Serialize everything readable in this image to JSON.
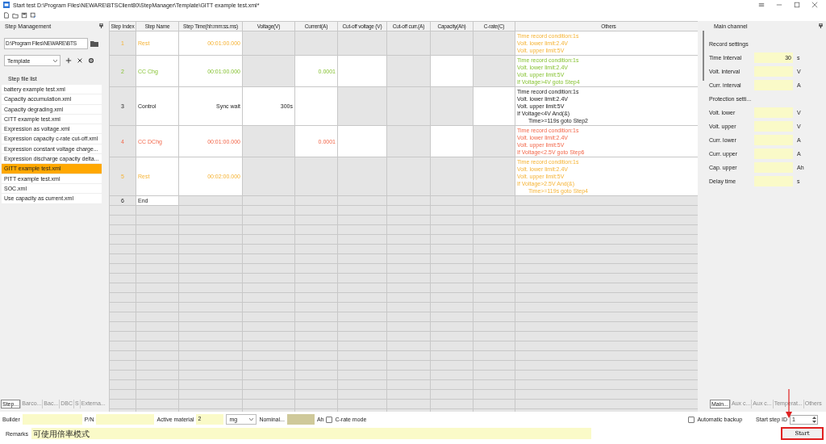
{
  "window": {
    "title": "Start test D:\\Program Files\\NEWARE\\BTSClient80\\StepManager\\Template\\GITT example test.xml*"
  },
  "step_management": {
    "title": "Step Management",
    "path": "D:\\Program Files\\NEWARE\\BTS",
    "category": "Template",
    "list_title": "Step file list",
    "files": [
      {
        "name": "battery example test.xml",
        "selected": false
      },
      {
        "name": "Capacity accumulation.xml",
        "selected": false
      },
      {
        "name": "Capacity degrading.xml",
        "selected": false
      },
      {
        "name": "CITT example test.xml",
        "selected": false
      },
      {
        "name": "Expression as voltage.xml",
        "selected": false
      },
      {
        "name": "Expression capacity c-rate cut-off.xml",
        "selected": false
      },
      {
        "name": "Expression constant voltage charge...",
        "selected": false
      },
      {
        "name": "Expression discharge capacity delta...",
        "selected": false
      },
      {
        "name": "GITT example test.xml",
        "selected": true
      },
      {
        "name": "PITT example test.xml",
        "selected": false
      },
      {
        "name": "SOC.xml",
        "selected": false
      },
      {
        "name": "Use capacity as current.xml",
        "selected": false
      }
    ],
    "tabs": [
      {
        "label": "Step...",
        "selected": true
      },
      {
        "label": "Barco...",
        "selected": false
      },
      {
        "label": "Bac...",
        "selected": false
      },
      {
        "label": "DBC",
        "selected": false
      },
      {
        "label": "S",
        "selected": false
      },
      {
        "label": "Externa...",
        "selected": false
      }
    ]
  },
  "table": {
    "columns": [
      "Step Index",
      "Step Name",
      "Step Time(hh:mm:ss.ms)",
      "Voltage(V)",
      "Current(A)",
      "Cut-off voltage (V)",
      "Cut-off curr.(A)",
      "Capacity(Ah)",
      "C-rate(C)",
      "Others"
    ],
    "rows": [
      {
        "kind": "rest",
        "cells": [
          {
            "text": "1",
            "editable": false
          },
          {
            "text": "Rest",
            "editable": true
          },
          {
            "text": "00:01:00.000",
            "editable": true
          },
          {
            "editable": false
          },
          {
            "editable": false
          },
          {
            "editable": false
          },
          {
            "editable": false
          },
          {
            "editable": false
          },
          {
            "editable": false
          }
        ],
        "others": {
          "editable": true,
          "lines": [
            {
              "text": "Time record condition:1s",
              "indent": false
            },
            {
              "text": "Volt. lower limit:2.4V",
              "indent": false
            },
            {
              "text": "Volt. upper limit:5V",
              "indent": false
            }
          ]
        }
      },
      {
        "kind": "cc_chg",
        "cells": [
          {
            "text": "2",
            "editable": false
          },
          {
            "text": "CC Chg",
            "editable": true
          },
          {
            "text": "00:01:00.000",
            "editable": true
          },
          {
            "editable": false
          },
          {
            "text": "0.0001",
            "editable": true
          },
          {
            "editable": true
          },
          {
            "editable": false
          },
          {
            "editable": true
          },
          {
            "editable": false
          }
        ],
        "others": {
          "editable": true,
          "lines": [
            {
              "text": "Time record condition:1s",
              "indent": false
            },
            {
              "text": "Volt. lower limit:2.4V",
              "indent": false
            },
            {
              "text": "Volt. upper limit:5V",
              "indent": false
            },
            {
              "text": "If Voltage>4V goto Step4",
              "indent": false
            }
          ]
        }
      },
      {
        "kind": "control",
        "cells": [
          {
            "text": "3",
            "editable": false
          },
          {
            "text": "Control",
            "editable": true
          },
          {
            "text": "Sync wait",
            "editable": true
          },
          {
            "text": "300s",
            "editable": true
          },
          {
            "editable": true
          },
          {
            "editable": false
          },
          {
            "editable": false
          },
          {
            "editable": false
          },
          {
            "editable": true
          }
        ],
        "others": {
          "editable": true,
          "lines": [
            {
              "text": "Time record condition:1s",
              "indent": false
            },
            {
              "text": "Volt. lower limit:2.4V",
              "indent": false
            },
            {
              "text": "Volt. upper limit:5V",
              "indent": false
            },
            {
              "text": "If Voltage<4V And(&)",
              "indent": false
            },
            {
              "text": "Time>=119s goto Step2",
              "indent": true
            }
          ]
        }
      },
      {
        "kind": "cc_dchg",
        "cells": [
          {
            "text": "4",
            "editable": false
          },
          {
            "text": "CC DChg",
            "editable": true
          },
          {
            "text": "00:01:00.000",
            "editable": true
          },
          {
            "editable": false
          },
          {
            "text": "0.0001",
            "editable": true
          },
          {
            "editable": true
          },
          {
            "editable": false
          },
          {
            "editable": true
          },
          {
            "editable": false
          }
        ],
        "others": {
          "editable": true,
          "lines": [
            {
              "text": "Time record condition:1s",
              "indent": false
            },
            {
              "text": "Volt. lower limit:2.4V",
              "indent": false
            },
            {
              "text": "Volt. upper limit:5V",
              "indent": false
            },
            {
              "text": "If Voltage<2.5V goto Step6",
              "indent": false
            }
          ]
        }
      },
      {
        "kind": "rest",
        "cells": [
          {
            "text": "5",
            "editable": false
          },
          {
            "text": "Rest",
            "editable": true
          },
          {
            "text": "00:02:00.000",
            "editable": true
          },
          {
            "editable": false
          },
          {
            "editable": false
          },
          {
            "editable": false
          },
          {
            "editable": false
          },
          {
            "editable": false
          },
          {
            "editable": false
          }
        ],
        "others": {
          "editable": true,
          "lines": [
            {
              "text": "Time record condition:1s",
              "indent": false
            },
            {
              "text": "Volt. lower limit:2.4V",
              "indent": false
            },
            {
              "text": "Volt. upper limit:5V",
              "indent": false
            },
            {
              "text": "If Voltage>2.5V And(&)",
              "indent": false
            },
            {
              "text": "Time>=119s goto Step4",
              "indent": true
            }
          ]
        }
      },
      {
        "kind": "end",
        "cells": [
          {
            "text": "6",
            "editable": false
          },
          {
            "text": "End",
            "editable": true
          },
          {
            "editable": false
          },
          {
            "editable": false
          },
          {
            "editable": false
          },
          {
            "editable": false
          },
          {
            "editable": false
          },
          {
            "editable": false
          },
          {
            "editable": false
          }
        ],
        "others": {
          "editable": false
        }
      }
    ]
  },
  "main_channel": {
    "title": "Main channel",
    "settings": [
      {
        "kind": "heading",
        "label": "Record settings"
      },
      {
        "kind": "field",
        "label": "Time Interval",
        "value": "30",
        "unit": "s"
      },
      {
        "kind": "field",
        "label": "Volt. interval",
        "unit": "V"
      },
      {
        "kind": "field",
        "label": "Curr. interval",
        "unit": "A"
      },
      {
        "kind": "heading",
        "label": "Protection setti..."
      },
      {
        "kind": "field",
        "label": "Volt. lower",
        "unit": "V"
      },
      {
        "kind": "field",
        "label": "Volt. upper",
        "unit": "V"
      },
      {
        "kind": "field",
        "label": "Curr. lower",
        "unit": "A"
      },
      {
        "kind": "field",
        "label": "Curr. upper",
        "unit": "A"
      },
      {
        "kind": "field",
        "label": "Cap. upper",
        "unit": "Ah"
      },
      {
        "kind": "field",
        "label": "Delay time",
        "unit": "s"
      }
    ],
    "tabs": [
      {
        "label": "Main...",
        "selected": true
      },
      {
        "label": "Aux c...",
        "selected": false
      },
      {
        "label": "Aux c...",
        "selected": false
      },
      {
        "label": "Temperat...",
        "selected": false
      },
      {
        "label": "Others",
        "selected": false
      }
    ]
  },
  "form": {
    "builder_label": "Builder",
    "pn_label": "P/N",
    "active_material_label": "Active material",
    "active_material_value": "2",
    "unit": "mg",
    "nominal_label": "Nominal...",
    "nominal_unit": "Ah",
    "c_rate_mode": {
      "label": "C-rate mode",
      "checked": false
    },
    "automatic_backup": {
      "label": "Automatic backup",
      "checked": false
    },
    "start_step_label": "Start step ID",
    "start_step_value": "1",
    "remarks_label": "Remarks",
    "remarks_value": "可使用倍率模式",
    "start_button": "Start"
  }
}
